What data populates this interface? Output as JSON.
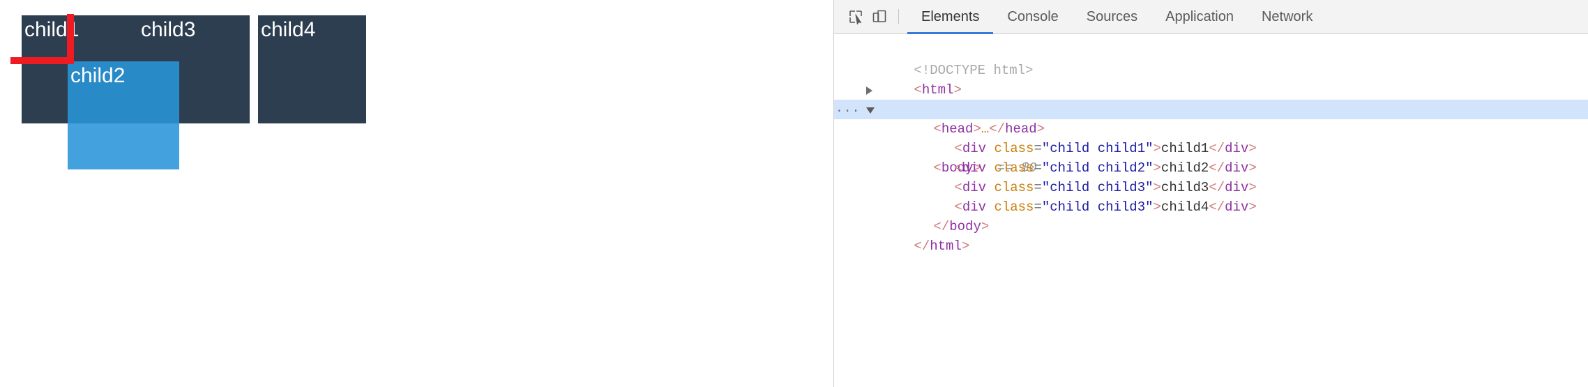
{
  "viewport": {
    "boxes": [
      {
        "id": "child1",
        "label": "child1",
        "kind": "dark"
      },
      {
        "id": "child2",
        "label": "child2",
        "kind": "blue"
      },
      {
        "id": "child3",
        "label": "child3",
        "kind": "dark"
      },
      {
        "id": "child4",
        "label": "child4",
        "kind": "dark"
      }
    ],
    "colors": {
      "dark_box": "#2d3e50",
      "blue_box": "#2995d8",
      "annotation": "#ee1b23",
      "page_background": "#ffffff"
    },
    "annotation": {
      "name": "red-corner-marker",
      "shape": "L-shaped elbow"
    }
  },
  "devtools": {
    "toolbar": {
      "inspect_icon": "inspect-element-icon",
      "device_icon": "device-toolbar-icon"
    },
    "tabs": [
      {
        "label": "Elements",
        "active": true
      },
      {
        "label": "Console",
        "active": false
      },
      {
        "label": "Sources",
        "active": false
      },
      {
        "label": "Application",
        "active": false
      },
      {
        "label": "Network",
        "active": false
      }
    ],
    "active_tab_underline_color": "#3a79d8",
    "selected_row_color": "#d2e4fb",
    "dom": {
      "doctype": "<!DOCTYPE html>",
      "html_open": {
        "lt": "<",
        "tag": "html",
        "gt": ">"
      },
      "head_row": {
        "lt": "<",
        "tag": "head",
        "gt": ">",
        "dots": "…",
        "close_lt": "</",
        "close_tag": "head",
        "close_gt": ">"
      },
      "body_row": {
        "ellipsis": "...",
        "lt": "<",
        "tag": "body",
        "gt": ">",
        "selector_ref": "== $0"
      },
      "children": [
        {
          "lt": "<",
          "tag": "div",
          "attr_name": "class",
          "eq": "=",
          "quote_open": "\"",
          "attr_value": "child child1",
          "quote_close": "\"",
          "gt": ">",
          "text": "child1",
          "close_lt": "</",
          "close_tag": "div",
          "close_gt": ">"
        },
        {
          "lt": "<",
          "tag": "div",
          "attr_name": "class",
          "eq": "=",
          "quote_open": "\"",
          "attr_value": "child child2",
          "quote_close": "\"",
          "gt": ">",
          "text": "child2",
          "close_lt": "</",
          "close_tag": "div",
          "close_gt": ">"
        },
        {
          "lt": "<",
          "tag": "div",
          "attr_name": "class",
          "eq": "=",
          "quote_open": "\"",
          "attr_value": "child child3",
          "quote_close": "\"",
          "gt": ">",
          "text": "child3",
          "close_lt": "</",
          "close_tag": "div",
          "close_gt": ">"
        },
        {
          "lt": "<",
          "tag": "div",
          "attr_name": "class",
          "eq": "=",
          "quote_open": "\"",
          "attr_value": "child child3",
          "quote_close": "\"",
          "gt": ">",
          "text": "child4",
          "close_lt": "</",
          "close_tag": "div",
          "close_gt": ">"
        }
      ],
      "body_close": {
        "lt": "</",
        "tag": "body",
        "gt": ">"
      },
      "html_close": {
        "lt": "</",
        "tag": "html",
        "gt": ">"
      }
    }
  }
}
